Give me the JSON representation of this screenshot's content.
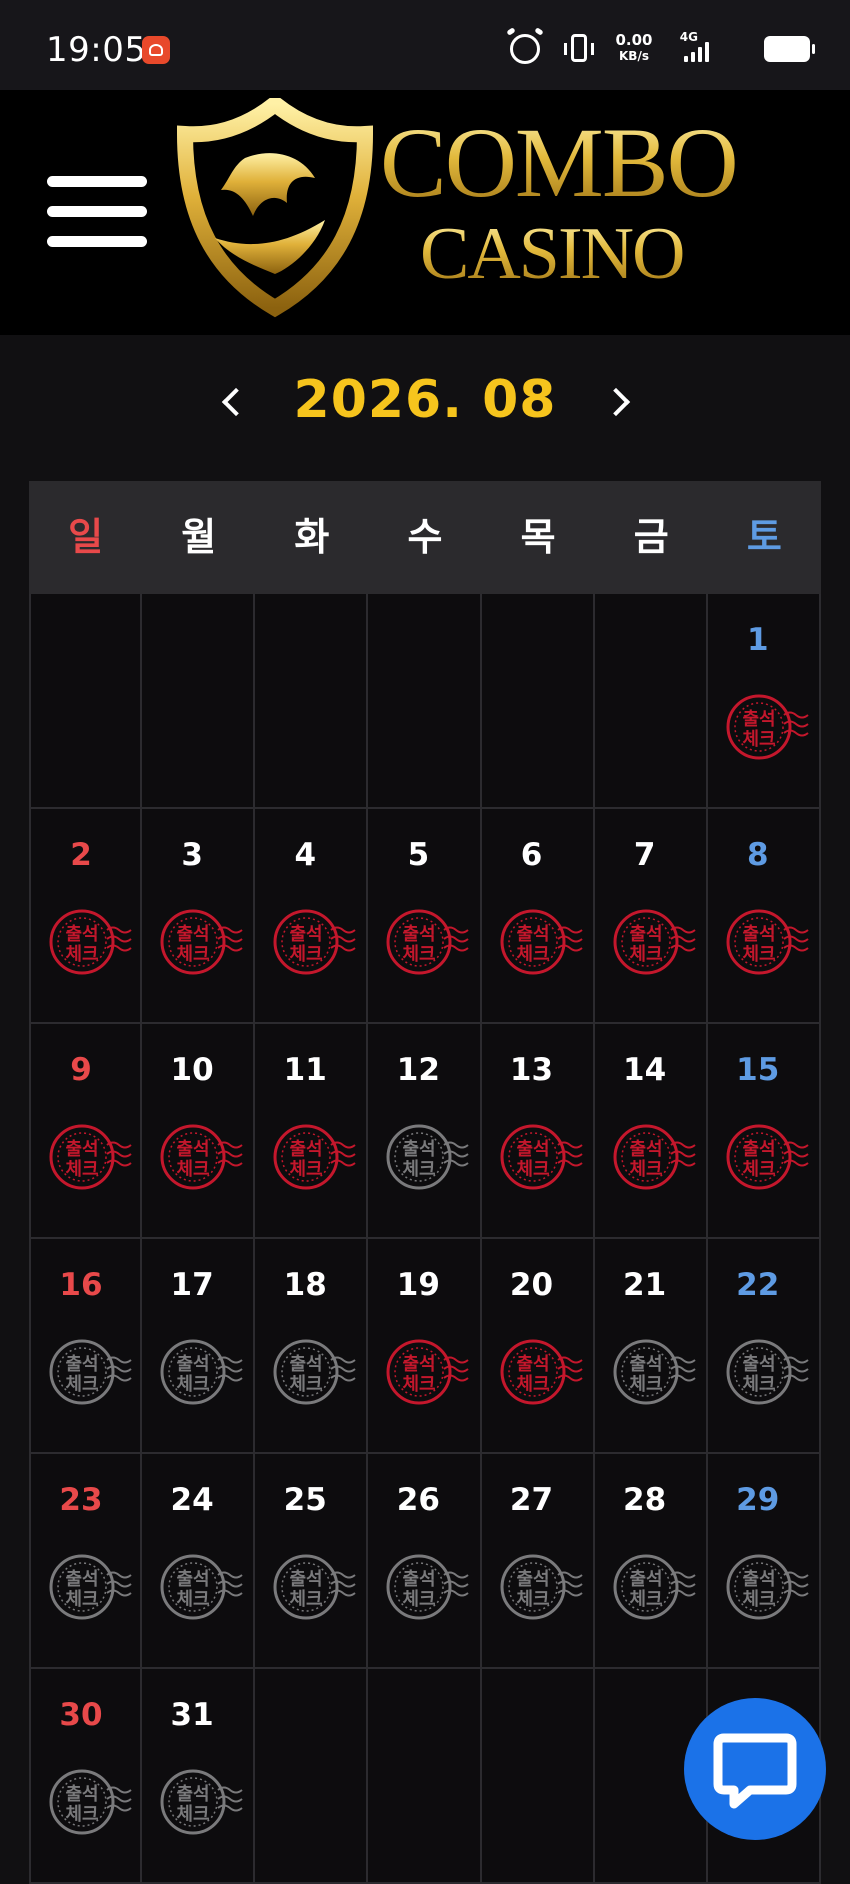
{
  "status_bar": {
    "time": "19:05",
    "net_speed_value": "0.00",
    "net_speed_unit": "KB/s",
    "signal_label": "4G",
    "icons": [
      "app-badge-icon",
      "alarm-icon",
      "vibrate-icon",
      "signal-icon",
      "battery-icon"
    ]
  },
  "header": {
    "logo_line1": "COMBO",
    "logo_line2": "CASINO",
    "menu_icon": "hamburger-menu-icon",
    "logo_color": "#d9b23a"
  },
  "calendar": {
    "month_title": "2026. 08",
    "prev_icon": "chevron-left-icon",
    "next_icon": "chevron-right-icon",
    "weekdays": [
      "일",
      "월",
      "화",
      "수",
      "목",
      "금",
      "토"
    ],
    "stamp_text_top": "출석",
    "stamp_text_bottom": "체크",
    "stamp_colors": {
      "checked": "#c4172c",
      "unchecked": "#7a7a7c"
    },
    "weekday_colors": {
      "sunday": "#e8494a",
      "saturday": "#5e9be3",
      "weekday": "#ffffff"
    },
    "accent_title_color": "#f6c41d",
    "weeks": [
      [
        null,
        null,
        null,
        null,
        null,
        null,
        {
          "day": "1",
          "checked": true
        }
      ],
      [
        {
          "day": "2",
          "checked": true
        },
        {
          "day": "3",
          "checked": true
        },
        {
          "day": "4",
          "checked": true
        },
        {
          "day": "5",
          "checked": true
        },
        {
          "day": "6",
          "checked": true
        },
        {
          "day": "7",
          "checked": true
        },
        {
          "day": "8",
          "checked": true
        }
      ],
      [
        {
          "day": "9",
          "checked": true
        },
        {
          "day": "10",
          "checked": true
        },
        {
          "day": "11",
          "checked": true
        },
        {
          "day": "12",
          "checked": false
        },
        {
          "day": "13",
          "checked": true
        },
        {
          "day": "14",
          "checked": true
        },
        {
          "day": "15",
          "checked": true
        }
      ],
      [
        {
          "day": "16",
          "checked": false
        },
        {
          "day": "17",
          "checked": false
        },
        {
          "day": "18",
          "checked": false
        },
        {
          "day": "19",
          "checked": true
        },
        {
          "day": "20",
          "checked": true
        },
        {
          "day": "21",
          "checked": false
        },
        {
          "day": "22",
          "checked": false
        }
      ],
      [
        {
          "day": "23",
          "checked": false
        },
        {
          "day": "24",
          "checked": false
        },
        {
          "day": "25",
          "checked": false
        },
        {
          "day": "26",
          "checked": false
        },
        {
          "day": "27",
          "checked": false
        },
        {
          "day": "28",
          "checked": false
        },
        {
          "day": "29",
          "checked": false
        }
      ],
      [
        {
          "day": "30",
          "checked": false
        },
        {
          "day": "31",
          "checked": false
        },
        null,
        null,
        null,
        null,
        null
      ]
    ]
  },
  "chat": {
    "icon": "chat-bubble-icon",
    "color": "#1b72e8"
  }
}
